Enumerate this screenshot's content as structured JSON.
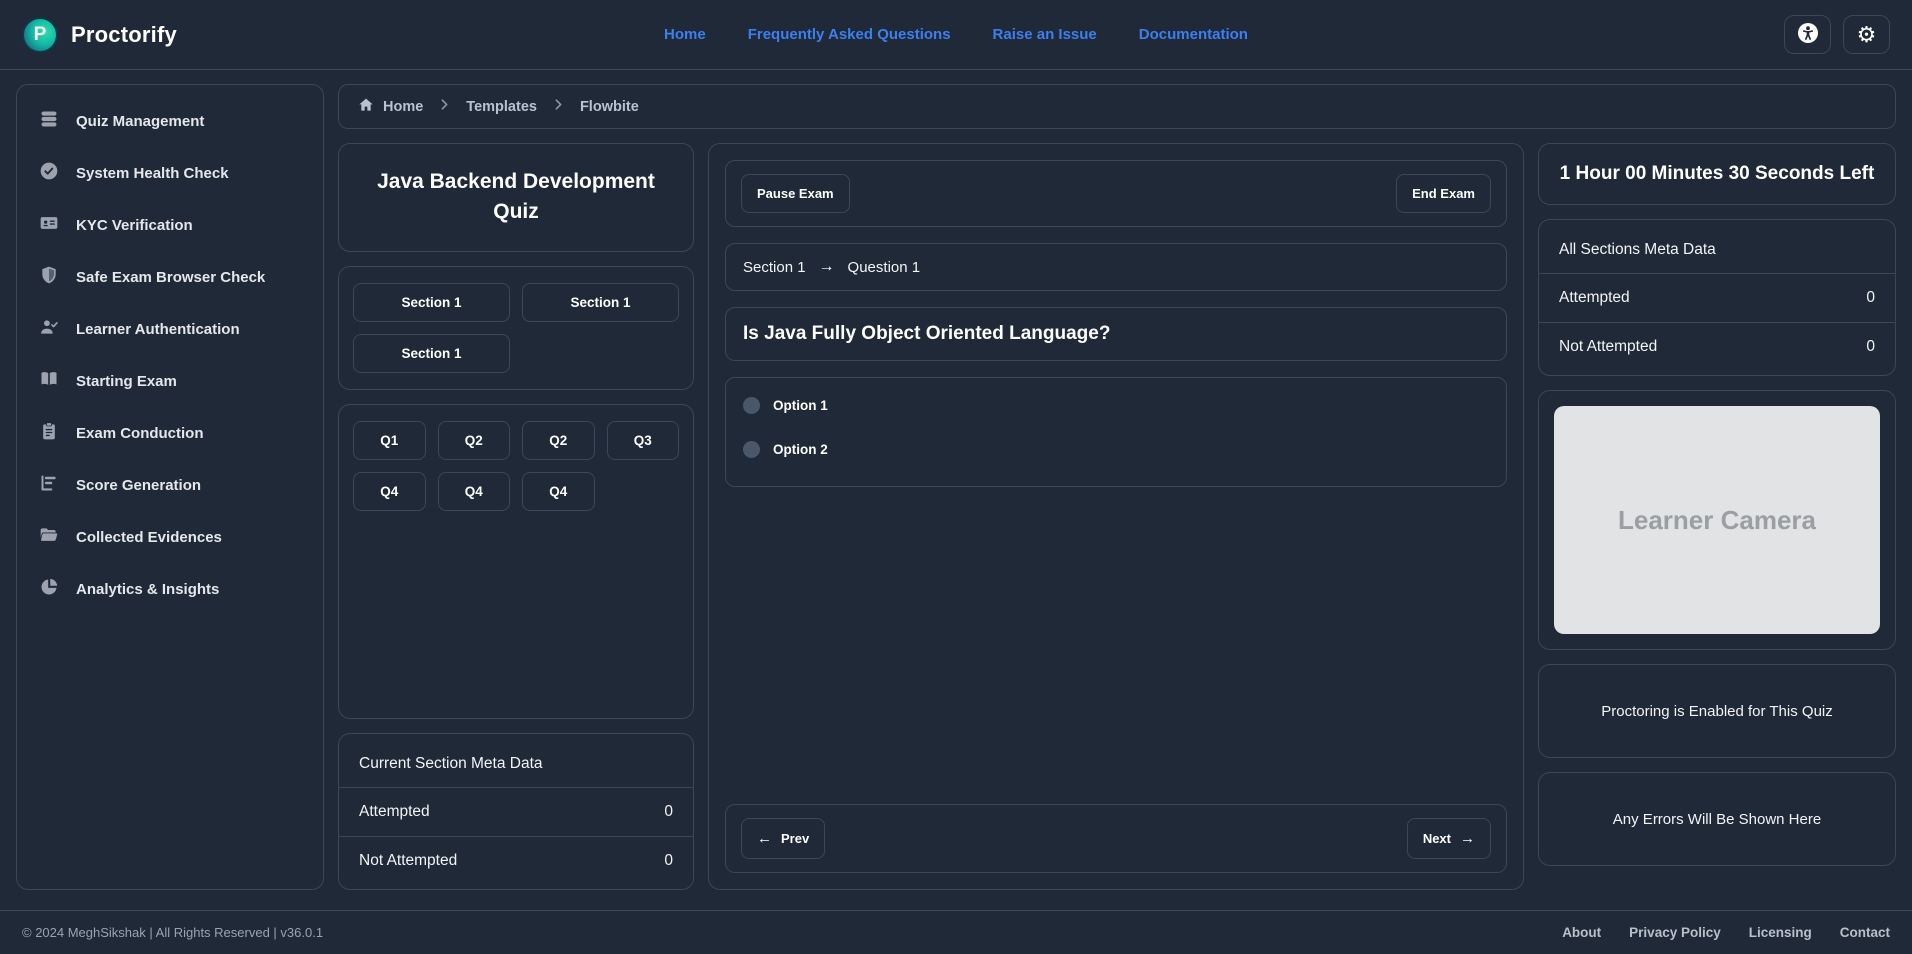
{
  "navbar": {
    "brand": "Proctorify",
    "logo_letter": "P",
    "links": [
      {
        "label": "Home"
      },
      {
        "label": "Frequently Asked Questions"
      },
      {
        "label": "Raise an Issue"
      },
      {
        "label": "Documentation"
      }
    ],
    "gear_glyph": "⚙"
  },
  "sidebar": {
    "items": [
      {
        "label": "Quiz Management",
        "icon": "database-icon"
      },
      {
        "label": "System Health Check",
        "icon": "check-circle-icon"
      },
      {
        "label": "KYC Verification",
        "icon": "id-card-icon"
      },
      {
        "label": "Safe Exam Browser Check",
        "icon": "shield-icon"
      },
      {
        "label": "Learner Authentication",
        "icon": "user-check-icon"
      },
      {
        "label": "Starting Exam",
        "icon": "book-open-icon"
      },
      {
        "label": "Exam Conduction",
        "icon": "clipboard-icon"
      },
      {
        "label": "Score Generation",
        "icon": "chart-bars-icon"
      },
      {
        "label": "Collected Evidences",
        "icon": "folder-open-icon"
      },
      {
        "label": "Analytics & Insights",
        "icon": "pie-chart-icon"
      }
    ]
  },
  "breadcrumb": {
    "items": [
      "Home",
      "Templates",
      "Flowbite"
    ]
  },
  "quiz_panel": {
    "title": "Java Backend Development Quiz",
    "sections": [
      "Section 1",
      "Section 1",
      "Section 1"
    ],
    "questions": [
      "Q1",
      "Q2",
      "Q2",
      "Q3",
      "Q4",
      "Q4",
      "Q4"
    ],
    "section_meta": {
      "title": "Current Section Meta Data",
      "rows": [
        {
          "label": "Attempted",
          "value": "0"
        },
        {
          "label": "Not Attempted",
          "value": "0"
        }
      ]
    }
  },
  "exam_panel": {
    "pause_label": "Pause Exam",
    "end_label": "End Exam",
    "section_label": "Section 1",
    "question_label": "Question 1",
    "arrow_right": "→",
    "arrow_left": "←",
    "question_text": "Is Java Fully Object Oriented Language?",
    "options": [
      {
        "label": "Option 1"
      },
      {
        "label": "Option 2"
      }
    ],
    "prev_label": "Prev",
    "next_label": "Next"
  },
  "proctor_panel": {
    "timer": "1 Hour 00 Minutes 30 Seconds Left",
    "all_meta": {
      "title": "All Sections Meta Data",
      "rows": [
        {
          "label": "Attempted",
          "value": "0"
        },
        {
          "label": "Not Attempted",
          "value": "0"
        }
      ]
    },
    "camera_placeholder": "Learner Camera",
    "proctoring_note": "Proctoring is Enabled for This Quiz",
    "errors_note": "Any Errors Will Be Shown Here"
  },
  "footer": {
    "copyright": "© 2024 MeghSikshak | All Rights Reserved | v36.0.1",
    "links": [
      {
        "label": "About"
      },
      {
        "label": "Privacy Policy"
      },
      {
        "label": "Licensing"
      },
      {
        "label": "Contact"
      }
    ]
  },
  "colors": {
    "background": "#1f2937",
    "border": "#3b4657",
    "link_blue": "#3d7ef0",
    "camera_bg": "#e2e3e4",
    "logo_teal": "#14b8a6"
  }
}
